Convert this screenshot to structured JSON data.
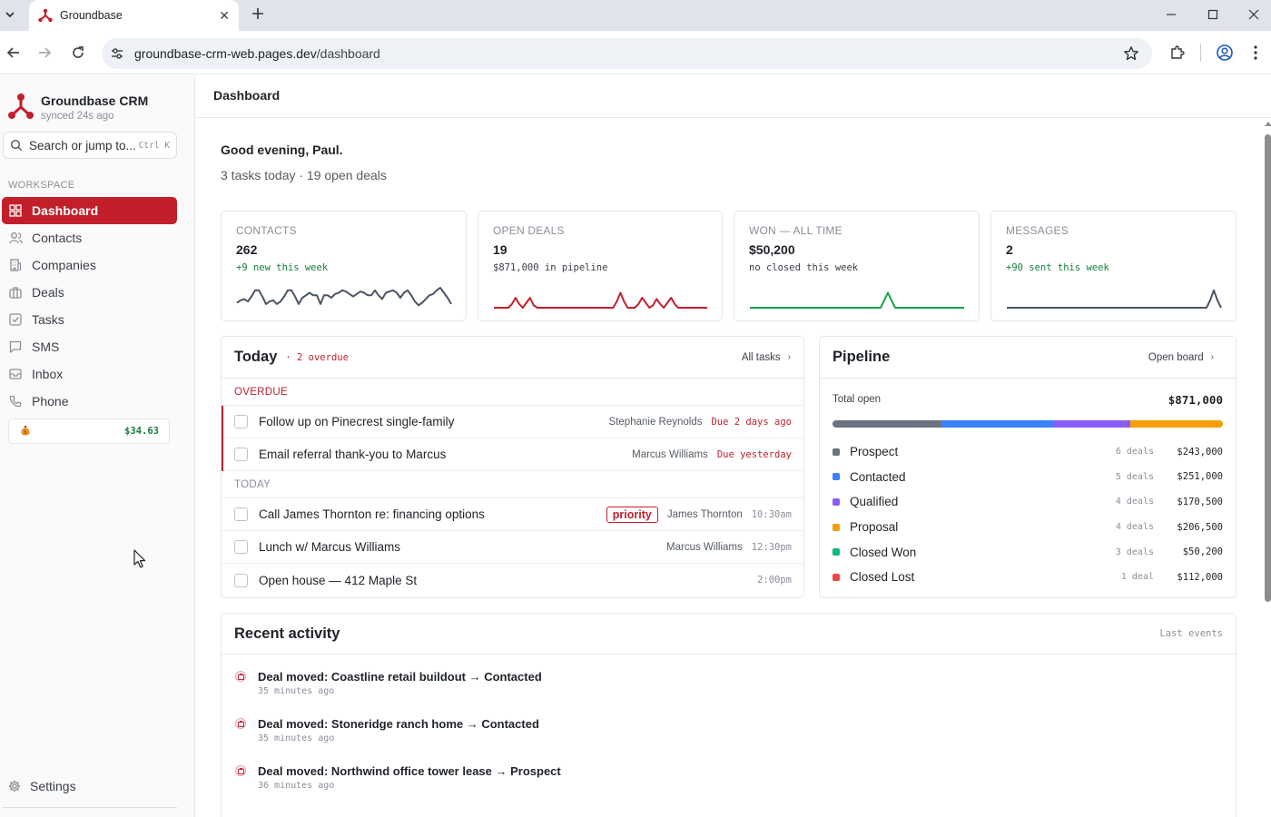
{
  "browser": {
    "tab_title": "Groundbase",
    "url_host": "groundbase-crm-web.pages.dev",
    "url_path": "/dashboard"
  },
  "sidebar": {
    "brand_name": "Groundbase CRM",
    "synced": "synced 24s ago",
    "search_placeholder": "Search or jump to...",
    "search_shortcut": "Ctrl K",
    "section_label": "WORKSPACE",
    "items": [
      {
        "label": "Dashboard",
        "icon": "grid-icon",
        "active": true
      },
      {
        "label": "Contacts",
        "icon": "users-icon"
      },
      {
        "label": "Companies",
        "icon": "building-icon"
      },
      {
        "label": "Deals",
        "icon": "briefcase-icon"
      },
      {
        "label": "Tasks",
        "icon": "checkbox-icon"
      },
      {
        "label": "SMS",
        "icon": "message-icon"
      },
      {
        "label": "Inbox",
        "icon": "inbox-icon"
      },
      {
        "label": "Phone",
        "icon": "phone-icon"
      }
    ],
    "balance_icon": "money-bag-icon",
    "balance": "$34.63",
    "settings_label": "Settings"
  },
  "header": {
    "title": "Dashboard"
  },
  "greeting": "Good evening, Paul.",
  "summary": "3 tasks today · 19 open deals",
  "stats": [
    {
      "label": "CONTACTS",
      "value": "262",
      "sub": "+9 new this week",
      "color": "#4b5563",
      "sub_color": "#17803d",
      "spark": [
        4,
        6,
        7,
        5,
        9,
        14,
        14,
        9,
        3,
        5,
        6,
        3,
        5,
        9,
        14,
        14,
        9,
        3,
        8,
        10,
        12,
        10,
        10,
        3,
        10,
        10,
        8,
        11,
        12,
        14,
        13,
        11,
        9,
        11,
        13,
        12,
        10,
        10,
        14,
        10,
        7,
        12,
        13,
        14,
        12,
        8,
        12,
        14,
        10,
        5,
        2,
        4,
        7,
        10,
        11,
        14,
        16,
        12,
        8,
        3
      ]
    },
    {
      "label": "OPEN DEALS",
      "value": "19",
      "sub": "$871,000 in pipeline",
      "color": "#c21f2b",
      "sub_color": "#3a3f47",
      "spark": [
        0,
        0,
        0,
        0,
        0,
        3,
        8,
        3,
        0,
        4,
        8,
        2,
        0,
        0,
        0,
        0,
        0,
        0,
        0,
        0,
        0,
        0,
        0,
        0,
        0,
        0,
        0,
        0,
        0,
        0,
        0,
        0,
        0,
        0,
        5,
        12,
        5,
        0,
        0,
        0,
        3,
        8,
        4,
        0,
        2,
        7,
        3,
        0,
        4,
        8,
        3,
        0,
        0,
        0,
        0,
        0,
        0,
        0,
        0,
        0
      ]
    },
    {
      "label": "WON — ALL TIME",
      "value": "$50,200",
      "sub": "no closed this week",
      "color": "#16a34a",
      "sub_color": "#3a3f47",
      "spark": [
        0,
        0,
        0,
        0,
        0,
        0,
        0,
        0,
        0,
        0,
        0,
        0,
        0,
        0,
        0,
        0,
        0,
        0,
        0,
        0,
        0,
        0,
        0,
        0,
        0,
        0,
        0,
        0,
        0,
        0,
        0,
        0,
        0,
        0,
        0,
        0,
        0,
        6,
        12,
        6,
        0,
        0,
        0,
        0,
        0,
        0,
        0,
        0,
        0,
        0,
        0,
        0,
        0,
        0,
        0,
        0,
        0,
        0,
        0,
        0
      ]
    },
    {
      "label": "MESSAGES",
      "value": "2",
      "sub": "+90 sent this week",
      "color": "#4b5563",
      "sub_color": "#17803d",
      "spark": [
        0,
        0,
        0,
        0,
        0,
        0,
        0,
        0,
        0,
        0,
        0,
        0,
        0,
        0,
        0,
        0,
        0,
        0,
        0,
        0,
        0,
        0,
        0,
        0,
        0,
        0,
        0,
        0,
        0,
        0,
        0,
        0,
        0,
        0,
        0,
        0,
        0,
        0,
        0,
        0,
        0,
        0,
        0,
        0,
        0,
        0,
        0,
        0,
        0,
        0,
        0,
        0,
        0,
        0,
        0,
        0,
        6,
        14,
        6,
        0
      ]
    }
  ],
  "today": {
    "title": "Today",
    "overdue_tag": "· 2 overdue",
    "link": "All tasks",
    "overdue_label": "OVERDUE",
    "today_label": "TODAY",
    "overdue_tasks": [
      {
        "title": "Follow up on Pinecrest single-family",
        "who": "Stephanie Reynolds",
        "due": "Due 2 days ago"
      },
      {
        "title": "Email referral thank-you to Marcus",
        "who": "Marcus Williams",
        "due": "Due yesterday"
      }
    ],
    "today_tasks": [
      {
        "title": "Call James Thornton re: financing options",
        "badge": "priority",
        "who": "James Thornton",
        "due": "10:30am"
      },
      {
        "title": "Lunch w/ Marcus Williams",
        "badge": "",
        "who": "Marcus Williams",
        "due": "12:30pm"
      },
      {
        "title": "Open house — 412 Maple St",
        "badge": "",
        "who": "",
        "due": "2:00pm"
      }
    ]
  },
  "pipeline": {
    "title": "Pipeline",
    "link": "Open board",
    "total_label": "Total open",
    "total": "$871,000",
    "bar_shares": [
      0.279,
      0.288,
      0.196,
      0.237
    ],
    "stages": [
      {
        "name": "Prospect",
        "count": "6 deals",
        "amount": "$243,000",
        "color": "#6b7280"
      },
      {
        "name": "Contacted",
        "count": "5 deals",
        "amount": "$251,000",
        "color": "#3b82f6"
      },
      {
        "name": "Qualified",
        "count": "4 deals",
        "amount": "$170,500",
        "color": "#8b5cf6"
      },
      {
        "name": "Proposal",
        "count": "4 deals",
        "amount": "$206,500",
        "color": "#f59e0b"
      },
      {
        "name": "Closed Won",
        "count": "3 deals",
        "amount": "$50,200",
        "color": "#10b981"
      },
      {
        "name": "Closed Lost",
        "count": "1 deal",
        "amount": "$112,000",
        "color": "#ef4444"
      }
    ]
  },
  "activity": {
    "title": "Recent activity",
    "meta": "Last events",
    "items": [
      {
        "title": "Deal moved: Coastline retail buildout → Contacted",
        "time": "35 minutes ago"
      },
      {
        "title": "Deal moved: Stoneridge ranch home → Contacted",
        "time": "35 minutes ago"
      },
      {
        "title": "Deal moved: Northwind office tower lease → Prospect",
        "time": "36 minutes ago"
      }
    ]
  }
}
